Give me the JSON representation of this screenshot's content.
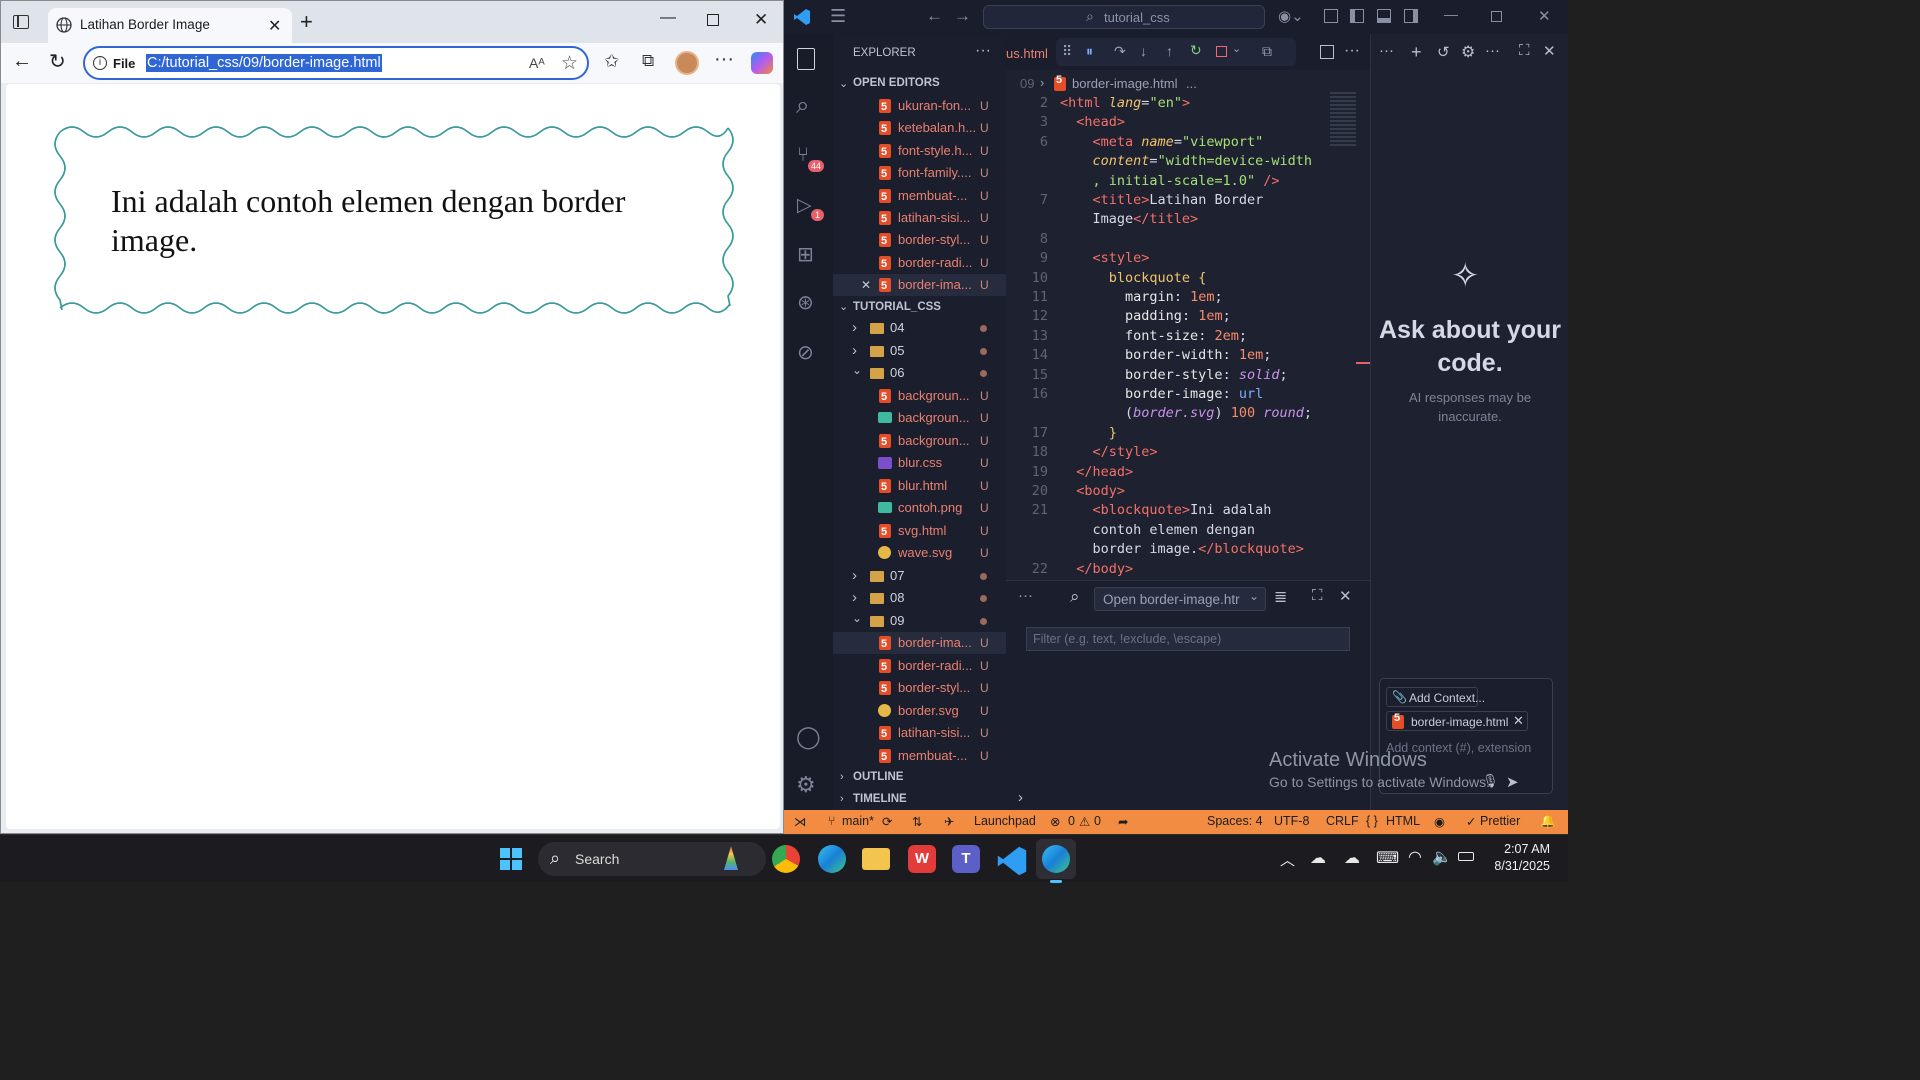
{
  "browser": {
    "tab_title": "Latihan Border Image",
    "address_label": "File",
    "url": "C:/tutorial_css/09/border-image.html",
    "read_aloud_label": "Aᴬ",
    "page_quote": "Ini adalah contoh elemen dengan border image."
  },
  "vscode": {
    "search_text": "tutorial_css",
    "explorer_title": "EXPLORER",
    "open_editors_title": "OPEN EDITORS",
    "project_title": "TUTORIAL_CSS",
    "open_editors": [
      {
        "name": "ukuran-fon...",
        "status": "U"
      },
      {
        "name": "ketebalan.h...",
        "status": "U"
      },
      {
        "name": "font-style.h...",
        "status": "U"
      },
      {
        "name": "font-family....",
        "status": "U"
      },
      {
        "name": "membuat-...",
        "status": "U"
      },
      {
        "name": "latihan-sisi...",
        "status": "U"
      },
      {
        "name": "border-styl...",
        "status": "U"
      },
      {
        "name": "border-radi...",
        "status": "U"
      },
      {
        "name": "border-ima...",
        "status": "U"
      }
    ],
    "folders_top": [
      "04",
      "05",
      "06"
    ],
    "folder06_files": [
      {
        "name": "backgroun...",
        "status": "U",
        "icon": "html"
      },
      {
        "name": "backgroun...",
        "status": "U",
        "icon": "image"
      },
      {
        "name": "backgroun...",
        "status": "U",
        "icon": "html"
      },
      {
        "name": "blur.css",
        "status": "U",
        "icon": "css"
      },
      {
        "name": "blur.html",
        "status": "U",
        "icon": "html"
      },
      {
        "name": "contoh.png",
        "status": "U",
        "icon": "image"
      },
      {
        "name": "svg.html",
        "status": "U",
        "icon": "html"
      },
      {
        "name": "wave.svg",
        "status": "U",
        "icon": "svg"
      }
    ],
    "folders_mid": [
      "07",
      "08",
      "09"
    ],
    "folder09_files": [
      {
        "name": "border-ima...",
        "status": "U",
        "icon": "html"
      },
      {
        "name": "border-radi...",
        "status": "U",
        "icon": "html"
      },
      {
        "name": "border-styl...",
        "status": "U",
        "icon": "html"
      },
      {
        "name": "border.svg",
        "status": "U",
        "icon": "svg"
      },
      {
        "name": "latihan-sisi...",
        "status": "U",
        "icon": "html"
      },
      {
        "name": "membuat-...",
        "status": "U",
        "icon": "html"
      }
    ],
    "outline_title": "OUTLINE",
    "timeline_title": "TIMELINE",
    "scm_badge": "44",
    "debug_badge": "1",
    "editor_tab": "us.html",
    "breadcrumb_file": "border-image.html",
    "breadcrumb_more": "...",
    "breadcrumb_line": "09",
    "panel_filter_placeholder": "Filter (e.g. text, !exclude, \\escape)",
    "panel_select": "Open border-image.htr",
    "chat_title": "Ask about your code.",
    "chat_subtitle": "AI responses may be inaccurate.",
    "add_context_label": "Add Context...",
    "context_file": "border-image.html",
    "chat_input_placeholder": "Add context (#), extension",
    "activate_title": "Activate Windows",
    "activate_sub": "Go to Settings to activate Windows.",
    "status": {
      "branch": "main*",
      "launchpad": "Launchpad",
      "errors": "0",
      "warnings": "0",
      "spaces": "Spaces: 4",
      "encoding": "UTF-8",
      "eol": "CRLF",
      "language": "HTML",
      "formatter": "Prettier"
    }
  },
  "taskbar": {
    "search_label": "Search",
    "time": "2:07 AM",
    "date": "8/31/2025"
  }
}
